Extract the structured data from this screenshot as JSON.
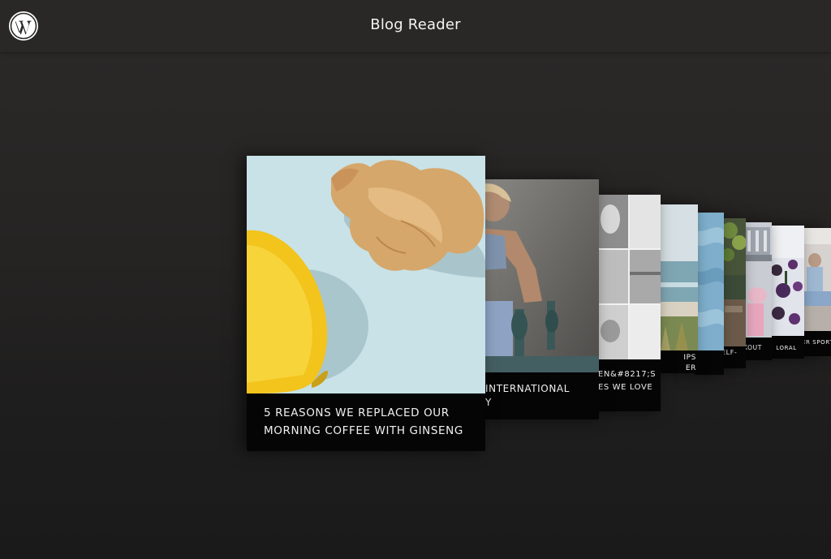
{
  "app": {
    "title": "Blog Reader",
    "logo_icon": "wordpress-icon"
  },
  "colors": {
    "topbar": "#292827",
    "background": "#262423",
    "caption_bg": "#050505",
    "caption_text": "#f0f0f0"
  },
  "cards": [
    {
      "title_line1": "5 REASONS WE REPLACED OUR",
      "title_line2": "MORNING COFFEE WITH GINSENG",
      "image": "ginger-and-lemon"
    },
    {
      "title_line1": "INTERNATIONAL",
      "title_line2": "Y",
      "image": "woman-in-sports-bra"
    },
    {
      "title_line1": "EN&#8217;S",
      "title_line2": "ES WE LOVE",
      "image": "black-and-white-photo-grid"
    },
    {
      "title_line1": "IPS",
      "title_line2": "ER",
      "image": "ocean-beach"
    },
    {
      "title_line1": "",
      "title_line2": "",
      "image": "blue-textile"
    },
    {
      "title_line1": "ELF-",
      "title_line2": "",
      "image": "potted-plants"
    },
    {
      "title_line1": "KOUT",
      "title_line2": "",
      "image": "workout"
    },
    {
      "title_line1": "LORAL",
      "title_line2": "",
      "image": "floral"
    },
    {
      "title_line1": "ER SPORT-",
      "title_line2": "",
      "image": "sport"
    }
  ]
}
